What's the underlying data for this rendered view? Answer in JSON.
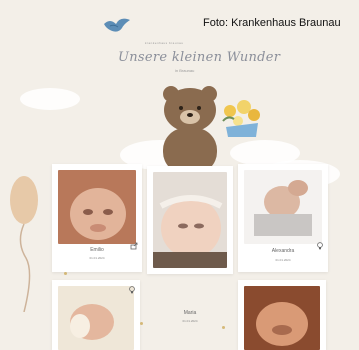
{
  "credit": "Foto: Krankenhaus Braunau",
  "header": {
    "kicker": "krankenhaus braunau",
    "title": "Unsere kleinen Wunder",
    "subtitle": "in Braunau"
  },
  "cards": [
    {
      "name": "Emilio",
      "date": "01.01.2024"
    },
    {
      "name": "",
      "date": ""
    },
    {
      "name": "Alexandra",
      "date": "01.01.2024"
    },
    {
      "name": "",
      "date": ""
    },
    {
      "name": "Maria",
      "date": "01.01.2024"
    },
    {
      "name": "",
      "date": ""
    }
  ],
  "colors": {
    "background": "#f3efe8",
    "title": "#8b8f9a",
    "bear": "#8a6b4f",
    "balloon": "#e7c9a8",
    "bird": "#5c8db6"
  },
  "icons": [
    "bird-logo-icon",
    "teddy-bear-illustration",
    "flower-bouquet-illustration",
    "balloon-illustration",
    "share-icon",
    "lightbulb-icon"
  ]
}
